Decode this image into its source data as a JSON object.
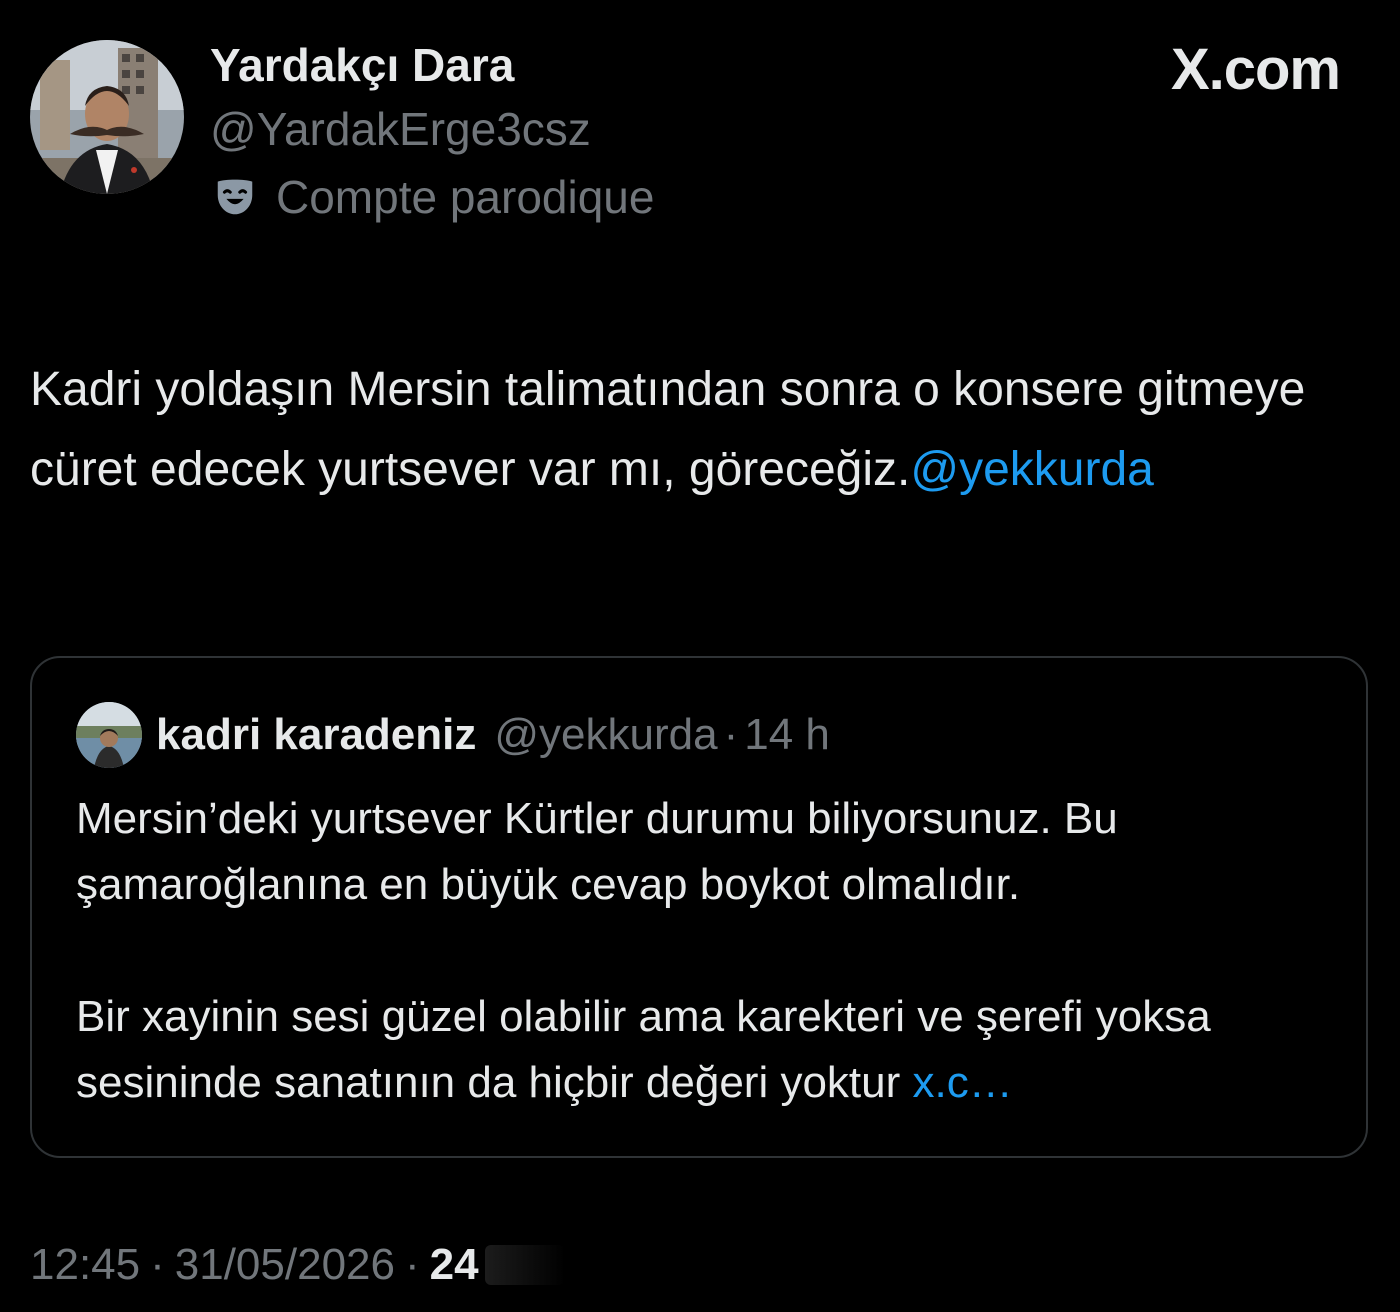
{
  "header": {
    "display_name": "Yardakçı Dara",
    "handle": "@YardakErge3csz",
    "label_icon": "theater-mask-icon",
    "label": "Compte parodique",
    "brand": "X.com"
  },
  "tweet": {
    "text": "Kadri yoldaşın Mersin talimatından sonra o konsere gitmeye cüret edecek yurtsever var mı, göreceğiz.",
    "mention": "@yekkurda"
  },
  "quote": {
    "name": "kadri karadeniz",
    "handle": "@yekkurda",
    "separator": "·",
    "time": "14 h",
    "paragraph1": "Mersin’deki yurtsever Kürtler durumu biliyorsunuz. Bu şamaroğlanına en büyük cevap boykot olmalıdır.",
    "paragraph2": "Bir xayinin sesi güzel olabilir ama karekteri ve şerefi yoksa sesininde sanatının da hiçbir değeri yoktur",
    "link": "x.c…"
  },
  "footer": {
    "time": "12:45",
    "separator": "·",
    "date": "31/05/2026",
    "count": "24"
  },
  "colors": {
    "background": "#000000",
    "text": "#e7e9ea",
    "secondary": "#71767b",
    "link": "#1d9bf0",
    "border": "#2f3336"
  }
}
